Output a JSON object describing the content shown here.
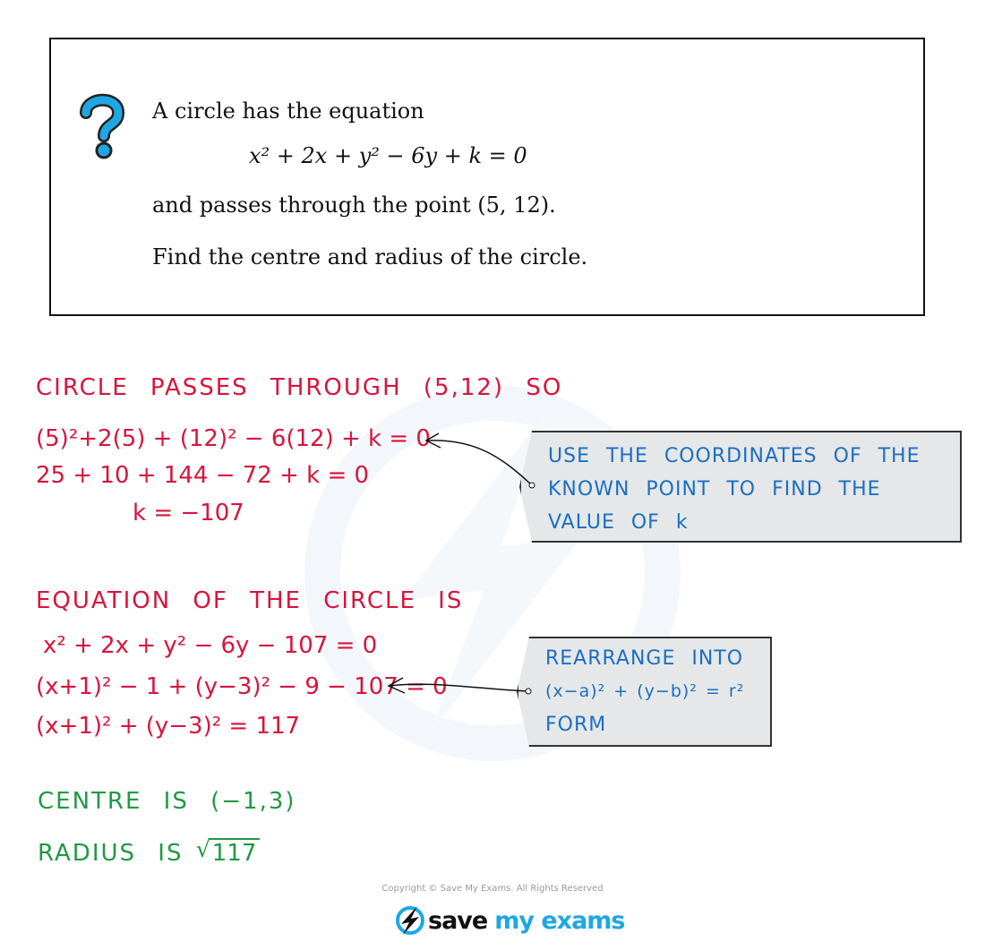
{
  "question": {
    "line1": "A circle has the equation",
    "equation": "x² + 2x + y² − 6y + k = 0",
    "line2": "and passes through the point (5, 12).",
    "line3": "Find the centre and radius of the circle."
  },
  "solution": {
    "heading1": "CIRCLE PASSES THROUGH (5,12) SO",
    "step1": [
      "(5)²+2(5) + (12)² − 6(12) + k = 0",
      "25 + 10 + 144 − 72 + k = 0",
      "k = −107"
    ],
    "note1": [
      "USE THE COORDINATES OF THE",
      "KNOWN POINT TO FIND THE",
      "VALUE OF k"
    ],
    "heading2": "EQUATION OF THE CIRCLE IS",
    "step2": [
      "x² + 2x + y² − 6y − 107 = 0",
      "(x+1)² − 1 + (y−3)² − 9 − 107 = 0",
      "(x+1)² + (y−3)² = 117"
    ],
    "note2": [
      "REARRANGE INTO",
      "(x−a)² + (y−b)² = r²",
      "FORM"
    ],
    "centre": "CENTRE IS (−1,3)",
    "radius_label": "RADIUS IS",
    "radius_value": "117"
  },
  "footer": {
    "copyright": "Copyright © Save My Exams. All Rights Reserved",
    "logo_save": "save",
    "logo_myexams": "my exams"
  },
  "colors": {
    "working": "#d6153c",
    "answer": "#1f9a44",
    "note_text": "#1a6fc4",
    "note_bg": "#e6e7e8",
    "brand": "#1ea7e4"
  }
}
